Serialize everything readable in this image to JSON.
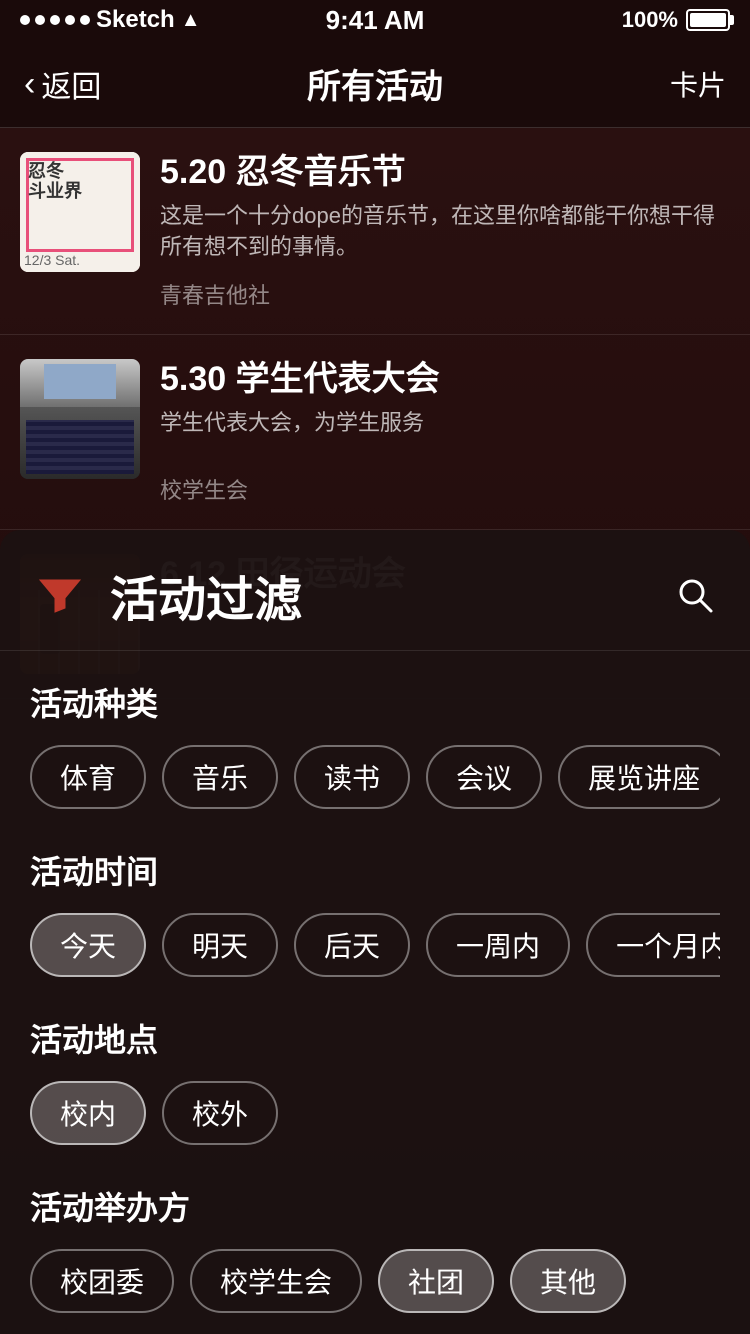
{
  "status": {
    "carrier": "Sketch",
    "time": "9:41 AM",
    "battery": "100%"
  },
  "nav": {
    "back_label": "返回",
    "title": "所有活动",
    "right_label": "卡片"
  },
  "activities": [
    {
      "id": "1",
      "thumb_type": "poster",
      "date_label": "12/3 Sat.",
      "title": "5.20 忍冬音乐节",
      "desc": "这是一个十分dope的音乐节，在这里你啥都能干你想干得所有想不到的事情。",
      "org": "青春吉他社"
    },
    {
      "id": "2",
      "thumb_type": "auditorium",
      "title": "5.30 学生代表大会",
      "desc": "学生代表大会，为学生服务",
      "org": "校学生会"
    },
    {
      "id": "3",
      "thumb_type": "track",
      "title": "6.12 田径运动会",
      "desc": "",
      "org": ""
    }
  ],
  "filter": {
    "title": "活动过滤",
    "search_icon": "search",
    "funnel_icon": "funnel",
    "sections": [
      {
        "id": "type",
        "title": "活动种类",
        "tags": [
          "体育",
          "音乐",
          "读书",
          "会议",
          "展览讲座"
        ]
      },
      {
        "id": "time",
        "title": "活动时间",
        "tags": [
          "今天",
          "明天",
          "后天",
          "一周内",
          "一个月内"
        ]
      },
      {
        "id": "location",
        "title": "活动地点",
        "tags": [
          "校内",
          "校外"
        ]
      },
      {
        "id": "organizer",
        "title": "活动举办方",
        "tags": [
          "校团委",
          "校学生会",
          "社团",
          "其他"
        ]
      }
    ]
  }
}
